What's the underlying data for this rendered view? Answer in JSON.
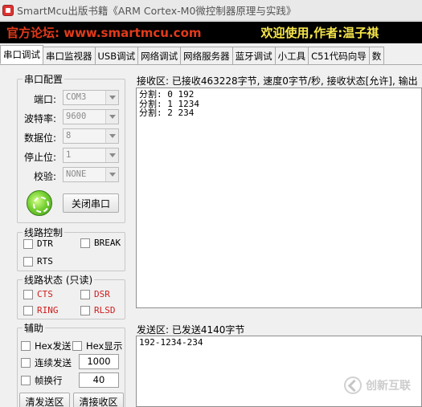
{
  "window": {
    "title": "SmartMcu出版书籍《ARM Cortex-M0微控制器原理与实践》"
  },
  "banner": {
    "left": "官方论坛: www.smartmcu.com",
    "right": "欢迎使用,作者:温子祺"
  },
  "tabs": [
    {
      "label": "串口调试",
      "active": true
    },
    {
      "label": "串口监视器"
    },
    {
      "label": "USB调试"
    },
    {
      "label": "网络调试"
    },
    {
      "label": "网络服务器"
    },
    {
      "label": "蓝牙调试"
    },
    {
      "label": "小工具"
    },
    {
      "label": "C51代码向导"
    },
    {
      "label": "数"
    }
  ],
  "serial_config": {
    "legend": "串口配置",
    "port_label": "端口:",
    "port_value": "COM3",
    "baud_label": "波特率:",
    "baud_value": "9600",
    "databits_label": "数据位:",
    "databits_value": "8",
    "stopbits_label": "停止位:",
    "stopbits_value": "1",
    "parity_label": "校验:",
    "parity_value": "NONE",
    "close_button": "关闭串口"
  },
  "line_control": {
    "legend": "线路控制",
    "dtr": "DTR",
    "brk": "BREAK",
    "rts": "RTS"
  },
  "line_status": {
    "legend": "线路状态 (只读)",
    "cts": "CTS",
    "dsr": "DSR",
    "ring": "RING",
    "rlsd": "RLSD"
  },
  "aux": {
    "legend": "辅助",
    "hex_send": "Hex发送",
    "hex_display": "Hex显示",
    "continuous_send": "连续发送",
    "interval_value": "1000",
    "frame_newline": "帧换行",
    "frame_value": "40",
    "clear_send": "清发送区",
    "clear_receive": "清接收区"
  },
  "receive": {
    "title": "接收区: 已接收463228字节, 速度0字节/秒, 接收状态[允许], 输出",
    "lines": [
      "分割: 0  192",
      "分割: 1 1234",
      "分割: 2 234"
    ]
  },
  "send": {
    "title": "发送区: 已发送4140字节",
    "text": "192-1234-234"
  },
  "watermark": {
    "text": "创新互联"
  }
}
